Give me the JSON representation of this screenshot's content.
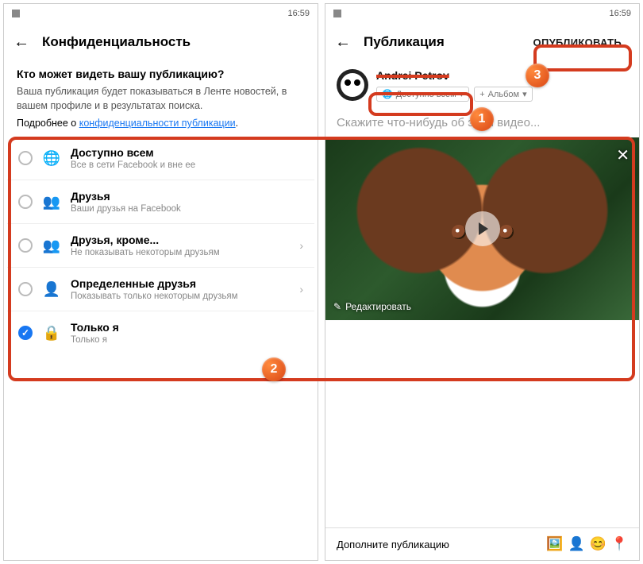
{
  "status_time": "16:59",
  "left": {
    "title": "Конфиденциальность",
    "question": "Кто может видеть вашу публикацию?",
    "description": "Ваша публикация будет показываться в Ленте новостей, в вашем профиле и в результатах поиска.",
    "more_prefix": "Подробнее о ",
    "more_link": "конфиденциальности публикации",
    "more_suffix": ".",
    "options": [
      {
        "title": "Доступно всем",
        "sub": "Все в сети Facebook и вне ее",
        "icon": "🌐",
        "checked": false,
        "chevron": false
      },
      {
        "title": "Друзья",
        "sub": "Ваши друзья на Facebook",
        "icon": "👥",
        "checked": false,
        "chevron": false
      },
      {
        "title": "Друзья, кроме...",
        "sub": "Не показывать некоторым друзьям",
        "icon": "👥",
        "checked": false,
        "chevron": true
      },
      {
        "title": "Определенные друзья",
        "sub": "Показывать только некоторым друзьям",
        "icon": "👤",
        "checked": false,
        "chevron": true
      },
      {
        "title": "Только я",
        "sub": "Только я",
        "icon": "🔒",
        "checked": true,
        "chevron": false
      }
    ]
  },
  "right": {
    "title": "Публикация",
    "publish": "ОПУБЛИКОВАТЬ",
    "user_name": "Andrei Petrov",
    "pill_audience": "Доступно всем",
    "pill_album": "Альбом",
    "prompt": "Скажите что-нибудь об этом видео...",
    "edit_label": "Редактировать",
    "footer_text": "Дополните публикацию"
  },
  "badges": {
    "b1": "1",
    "b2": "2",
    "b3": "3"
  }
}
